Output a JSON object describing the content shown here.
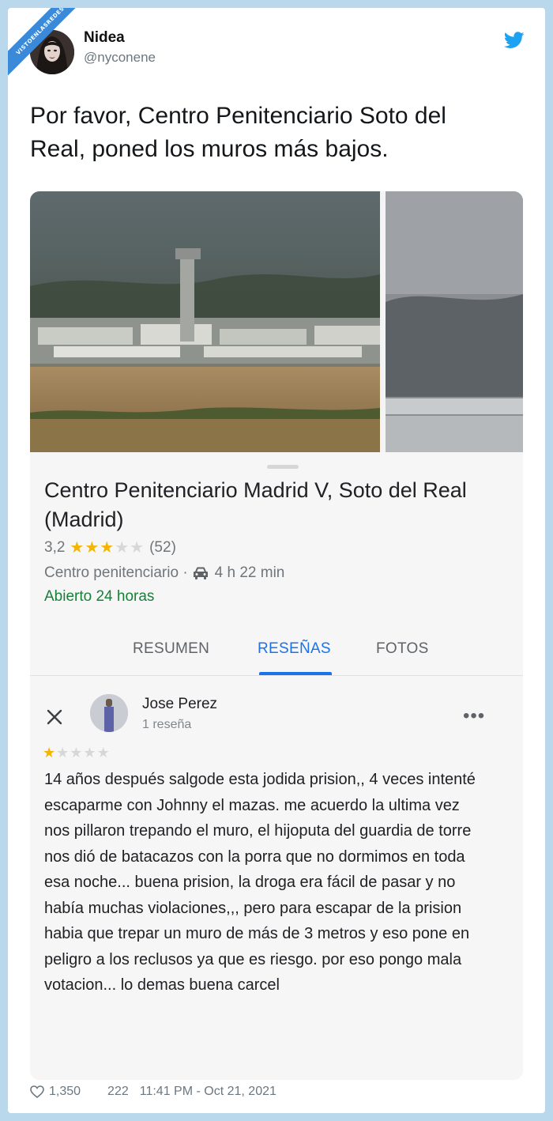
{
  "watermark": "VISTOENLASREDES",
  "tweet": {
    "author_name": "Nidea",
    "author_handle": "@nyconene",
    "text": "Por favor, Centro Penitenciario Soto del Real, poned los muros más bajos.",
    "likes": "1,350",
    "replies": "222",
    "timestamp": "11:41 PM - Oct 21, 2021"
  },
  "maps_card": {
    "place_title": "Centro Penitenciario Madrid V, Soto del Real (Madrid)",
    "rating": "3,2",
    "rating_stars": 3,
    "rating_count": "(52)",
    "category": "Centro penitenciario ·",
    "drive_time": "4 h 22 min",
    "open_status": "Abierto 24 horas",
    "tabs": [
      {
        "label": "RESUMEN",
        "active": false
      },
      {
        "label": "RESEÑAS",
        "active": true
      },
      {
        "label": "FOTOS",
        "active": false
      }
    ],
    "review": {
      "reviewer_name": "Jose Perez",
      "reviewer_meta": "1 reseña",
      "stars": 1,
      "text": "14 años después salgode esta jodida prision,, 4 veces intenté escaparme con Johnny el mazas. me acuerdo la ultima vez nos pillaron trepando el muro, el hijoputa del guardia de torre nos dió de batacazos con la porra que no dormimos en toda esa noche... buena prision, la droga era fácil de pasar y no había muchas violaciones,,, pero para escapar de la prision habia que trepar un muro de más de 3 metros y eso pone en peligro a los reclusos ya que es riesgo.  por eso pongo mala votacion... lo demas buena carcel"
    }
  },
  "colors": {
    "twitter_blue": "#1da1f2",
    "maps_blue": "#1a73e8",
    "open_green": "#188038",
    "star_gold": "#f4b400",
    "background": "#b9d8ec"
  }
}
